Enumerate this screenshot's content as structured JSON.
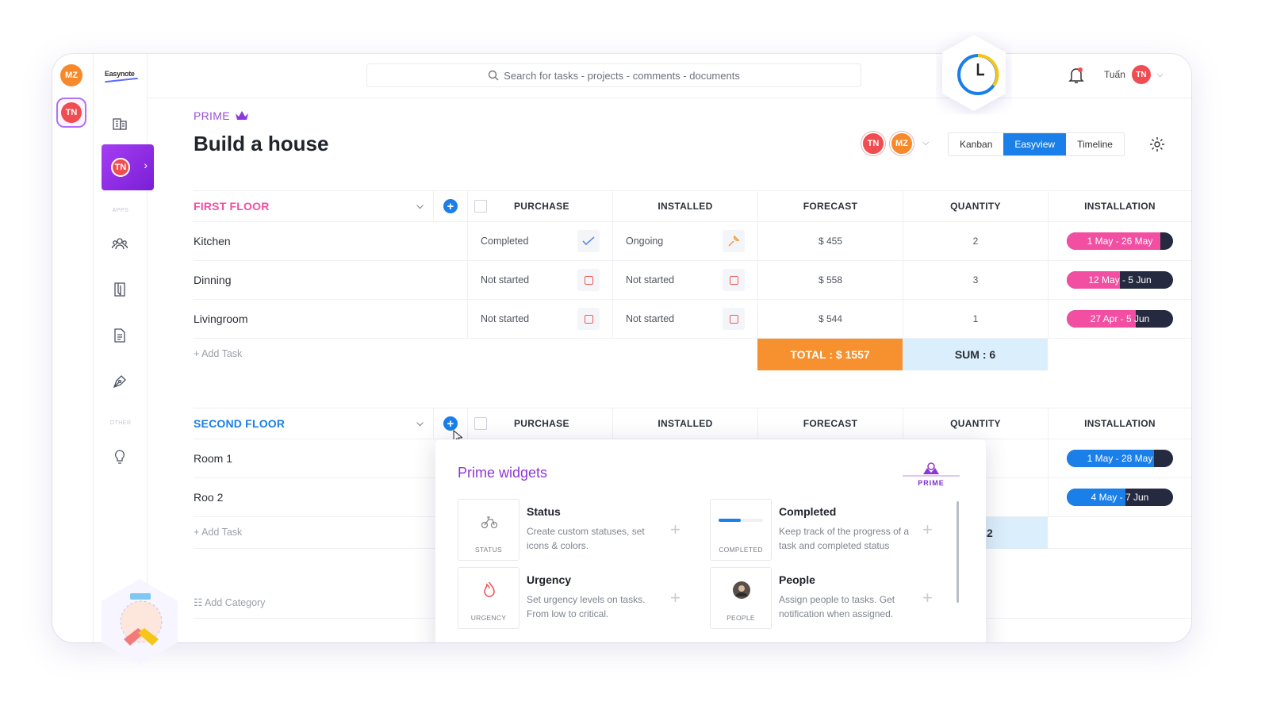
{
  "app": {
    "logo": "Easynote"
  },
  "rail": {
    "avatars": [
      "MZ",
      "TN"
    ]
  },
  "nav": {
    "project_avatar": "TN",
    "section_apps": "APPS",
    "section_other": "OTHER"
  },
  "search": {
    "placeholder": "Search for tasks - projects - comments - documents"
  },
  "user": {
    "name": "Tuấn",
    "initials": "TN"
  },
  "header": {
    "prime_label": "PRIME",
    "title": "Build a house",
    "members": [
      "TN",
      "MZ"
    ],
    "views": [
      "Kanban",
      "Easyview",
      "Timeline"
    ],
    "active_view": "Easyview"
  },
  "columns": [
    "PURCHASE",
    "INSTALLED",
    "FORECAST",
    "QUANTITY",
    "INSTALLATION"
  ],
  "groups": [
    {
      "name": "FIRST FLOOR",
      "color": "#f24fa2",
      "rows": [
        {
          "name": "Kitchen",
          "purchase": "Completed",
          "installed": "Ongoing",
          "forecast": "$ 455",
          "quantity": "2",
          "installation": "1 May - 26 May",
          "progress": 0.88
        },
        {
          "name": "Dinning",
          "purchase": "Not started",
          "installed": "Not started",
          "forecast": "$ 558",
          "quantity": "3",
          "installation": "12 May - 5 Jun",
          "progress": 0.5
        },
        {
          "name": "Livingroom",
          "purchase": "Not started",
          "installed": "Not started",
          "forecast": "$ 544",
          "quantity": "1",
          "installation": "27 Apr - 5 Jun",
          "progress": 0.65
        }
      ],
      "add_task": "+ Add Task",
      "total": "TOTAL : $ 1557",
      "sum": "SUM : 6"
    },
    {
      "name": "SECOND FLOOR",
      "color": "#1a7fe8",
      "rows": [
        {
          "name": "Room 1",
          "installation": "1 May - 28 May",
          "progress": 0.82
        },
        {
          "name": "Roo 2",
          "installation": "4 May - 7 Jun",
          "progress": 0.55
        }
      ],
      "add_task": "+ Add Task",
      "sum_partial": "2"
    }
  ],
  "add_category": "Add Category",
  "popup": {
    "title": "Prime widgets",
    "logo_text": "PRIME",
    "widgets": [
      {
        "title": "Status",
        "caption": "STATUS",
        "desc": "Create custom statuses, set icons & colors."
      },
      {
        "title": "Completed",
        "caption": "COMPLETED",
        "desc": "Keep track of the progress of a task and completed status"
      },
      {
        "title": "Urgency",
        "caption": "URGENCY",
        "desc": "Set urgency levels on tasks. From low to critical."
      },
      {
        "title": "People",
        "caption": "PEOPLE",
        "desc": "Assign people to tasks. Get notification when assigned."
      }
    ]
  },
  "colors": {
    "accent": "#1a7fe8",
    "prime": "#8e37d6",
    "pink": "#f24fa2",
    "orange": "#f7912f"
  }
}
